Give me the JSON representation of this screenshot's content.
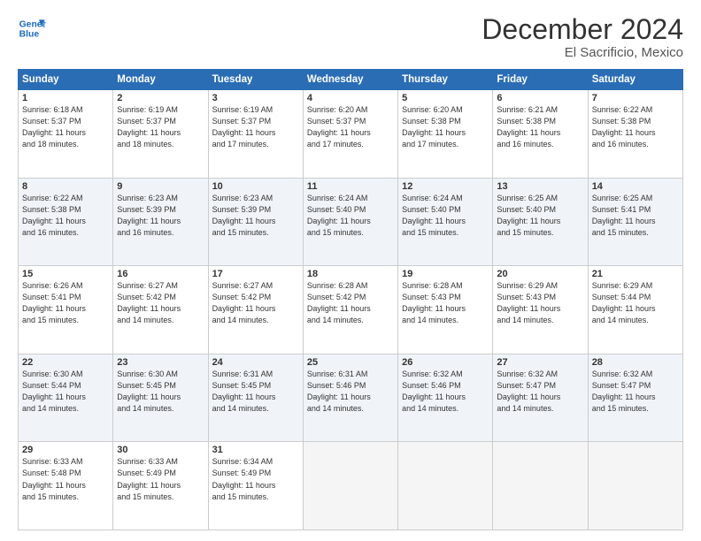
{
  "logo": {
    "line1": "General",
    "line2": "Blue"
  },
  "title": "December 2024",
  "location": "El Sacrificio, Mexico",
  "weekdays": [
    "Sunday",
    "Monday",
    "Tuesday",
    "Wednesday",
    "Thursday",
    "Friday",
    "Saturday"
  ],
  "weeks": [
    [
      {
        "day": "1",
        "sunrise": "6:18 AM",
        "sunset": "5:37 PM",
        "daylight": "11 hours and 18 minutes."
      },
      {
        "day": "2",
        "sunrise": "6:19 AM",
        "sunset": "5:37 PM",
        "daylight": "11 hours and 18 minutes."
      },
      {
        "day": "3",
        "sunrise": "6:19 AM",
        "sunset": "5:37 PM",
        "daylight": "11 hours and 17 minutes."
      },
      {
        "day": "4",
        "sunrise": "6:20 AM",
        "sunset": "5:37 PM",
        "daylight": "11 hours and 17 minutes."
      },
      {
        "day": "5",
        "sunrise": "6:20 AM",
        "sunset": "5:38 PM",
        "daylight": "11 hours and 17 minutes."
      },
      {
        "day": "6",
        "sunrise": "6:21 AM",
        "sunset": "5:38 PM",
        "daylight": "11 hours and 16 minutes."
      },
      {
        "day": "7",
        "sunrise": "6:22 AM",
        "sunset": "5:38 PM",
        "daylight": "11 hours and 16 minutes."
      }
    ],
    [
      {
        "day": "8",
        "sunrise": "6:22 AM",
        "sunset": "5:38 PM",
        "daylight": "11 hours and 16 minutes."
      },
      {
        "day": "9",
        "sunrise": "6:23 AM",
        "sunset": "5:39 PM",
        "daylight": "11 hours and 16 minutes."
      },
      {
        "day": "10",
        "sunrise": "6:23 AM",
        "sunset": "5:39 PM",
        "daylight": "11 hours and 15 minutes."
      },
      {
        "day": "11",
        "sunrise": "6:24 AM",
        "sunset": "5:40 PM",
        "daylight": "11 hours and 15 minutes."
      },
      {
        "day": "12",
        "sunrise": "6:24 AM",
        "sunset": "5:40 PM",
        "daylight": "11 hours and 15 minutes."
      },
      {
        "day": "13",
        "sunrise": "6:25 AM",
        "sunset": "5:40 PM",
        "daylight": "11 hours and 15 minutes."
      },
      {
        "day": "14",
        "sunrise": "6:25 AM",
        "sunset": "5:41 PM",
        "daylight": "11 hours and 15 minutes."
      }
    ],
    [
      {
        "day": "15",
        "sunrise": "6:26 AM",
        "sunset": "5:41 PM",
        "daylight": "11 hours and 15 minutes."
      },
      {
        "day": "16",
        "sunrise": "6:27 AM",
        "sunset": "5:42 PM",
        "daylight": "11 hours and 14 minutes."
      },
      {
        "day": "17",
        "sunrise": "6:27 AM",
        "sunset": "5:42 PM",
        "daylight": "11 hours and 14 minutes."
      },
      {
        "day": "18",
        "sunrise": "6:28 AM",
        "sunset": "5:42 PM",
        "daylight": "11 hours and 14 minutes."
      },
      {
        "day": "19",
        "sunrise": "6:28 AM",
        "sunset": "5:43 PM",
        "daylight": "11 hours and 14 minutes."
      },
      {
        "day": "20",
        "sunrise": "6:29 AM",
        "sunset": "5:43 PM",
        "daylight": "11 hours and 14 minutes."
      },
      {
        "day": "21",
        "sunrise": "6:29 AM",
        "sunset": "5:44 PM",
        "daylight": "11 hours and 14 minutes."
      }
    ],
    [
      {
        "day": "22",
        "sunrise": "6:30 AM",
        "sunset": "5:44 PM",
        "daylight": "11 hours and 14 minutes."
      },
      {
        "day": "23",
        "sunrise": "6:30 AM",
        "sunset": "5:45 PM",
        "daylight": "11 hours and 14 minutes."
      },
      {
        "day": "24",
        "sunrise": "6:31 AM",
        "sunset": "5:45 PM",
        "daylight": "11 hours and 14 minutes."
      },
      {
        "day": "25",
        "sunrise": "6:31 AM",
        "sunset": "5:46 PM",
        "daylight": "11 hours and 14 minutes."
      },
      {
        "day": "26",
        "sunrise": "6:32 AM",
        "sunset": "5:46 PM",
        "daylight": "11 hours and 14 minutes."
      },
      {
        "day": "27",
        "sunrise": "6:32 AM",
        "sunset": "5:47 PM",
        "daylight": "11 hours and 14 minutes."
      },
      {
        "day": "28",
        "sunrise": "6:32 AM",
        "sunset": "5:47 PM",
        "daylight": "11 hours and 15 minutes."
      }
    ],
    [
      {
        "day": "29",
        "sunrise": "6:33 AM",
        "sunset": "5:48 PM",
        "daylight": "11 hours and 15 minutes."
      },
      {
        "day": "30",
        "sunrise": "6:33 AM",
        "sunset": "5:49 PM",
        "daylight": "11 hours and 15 minutes."
      },
      {
        "day": "31",
        "sunrise": "6:34 AM",
        "sunset": "5:49 PM",
        "daylight": "11 hours and 15 minutes."
      },
      null,
      null,
      null,
      null
    ]
  ]
}
